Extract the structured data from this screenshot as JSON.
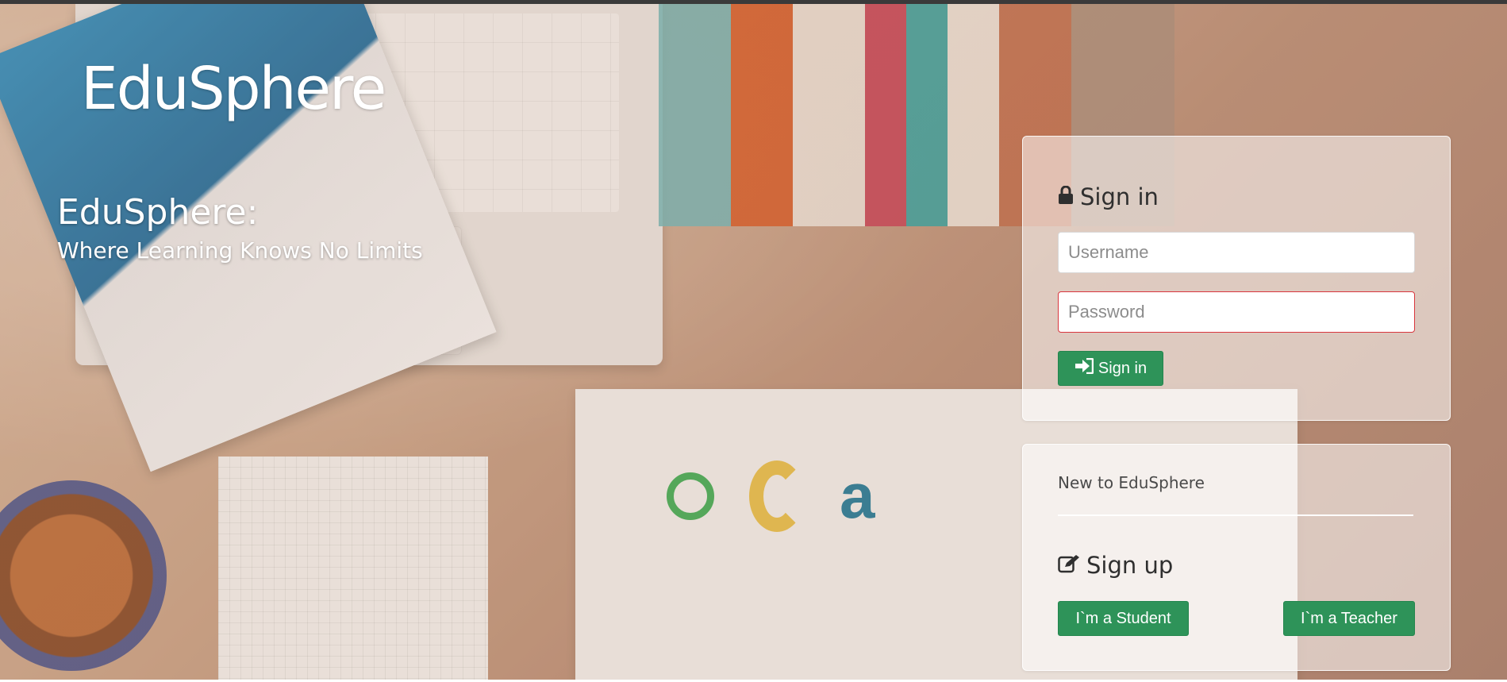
{
  "brand": {
    "name": "EduSphere"
  },
  "hero": {
    "title": "EduSphere:",
    "subtitle": "Where Learning Knows No Limits"
  },
  "signin": {
    "icon": "lock-icon",
    "title": "Sign in",
    "username_placeholder": "Username",
    "password_placeholder": "Password",
    "button_icon": "sign-in-arrow-icon",
    "button_label": "Sign in"
  },
  "signup": {
    "prompt": "New to EduSphere",
    "icon": "edit-icon",
    "title": "Sign up",
    "student_button": "I`m a Student",
    "teacher_button": "I`m a Teacher"
  },
  "colors": {
    "accent_green": "#2e9359",
    "error_border": "#d9363e",
    "topbar": "#3a3a3a"
  }
}
